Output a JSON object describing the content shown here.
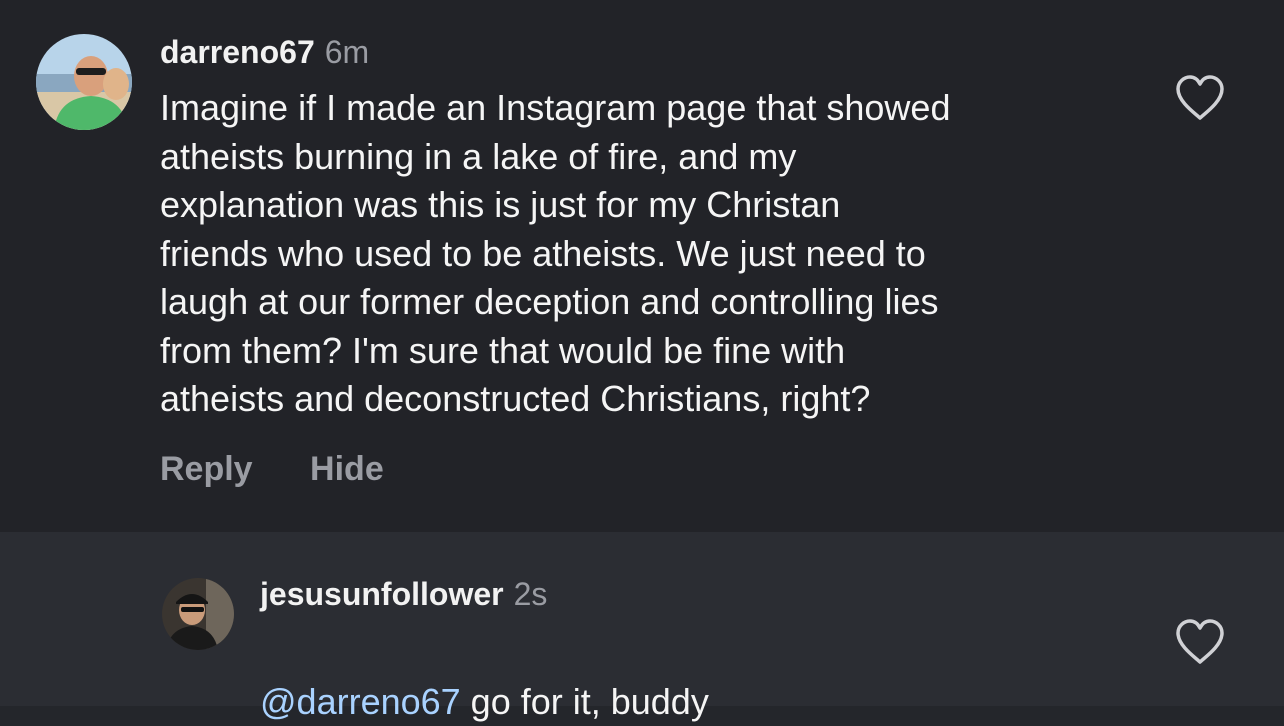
{
  "top_comment": {
    "username": "darreno67",
    "time": "6m",
    "text": "Imagine if I made an Instagram page that showed\natheists burning in a lake of fire, and my\nexplanation was this is just for my Christan\nfriends who used to be atheists.  We just need to\nlaugh at our former deception and controlling lies\nfrom them?  I'm sure that would be fine with\natheists and deconstructed Christians, right?",
    "reply_label": "Reply",
    "hide_label": "Hide",
    "like_icon": "heart-outline-icon"
  },
  "reply_comment": {
    "username": "jesusunfollower",
    "time": "2s",
    "mention": "@darreno67",
    "text": " go for it, buddy",
    "like_icon": "heart-outline-icon"
  },
  "colors": {
    "background_top": "#222328",
    "background_reply": "#2b2d33",
    "mention": "#a9d2ff",
    "muted": "#9a9ca3"
  }
}
